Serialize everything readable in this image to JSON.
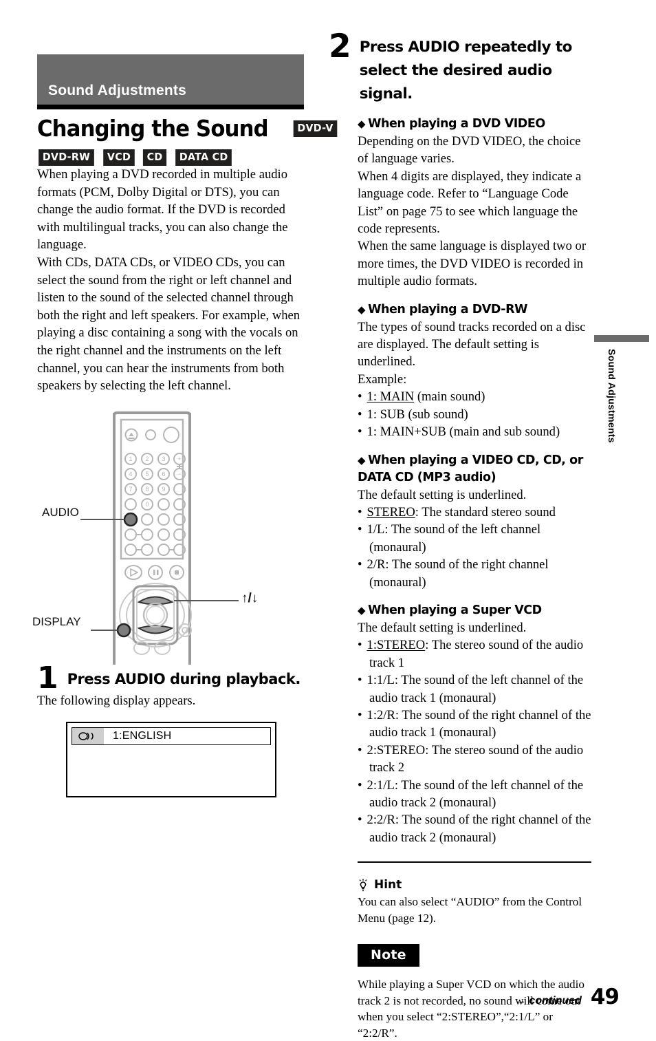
{
  "section": {
    "header": "Sound Adjustments",
    "title": "Changing the Sound",
    "badges_inline": [
      "DVD-V"
    ],
    "badges_row": [
      "DVD-RW",
      "VCD",
      "CD",
      "DATA CD"
    ]
  },
  "intro": {
    "p1": "When playing a DVD recorded in multiple audio formats (PCM, Dolby Digital or DTS), you can change the audio format. If the DVD is recorded with multilingual tracks, you can also change the language.",
    "p2": "With CDs, DATA CDs, or VIDEO CDs, you can select the sound from the right or left channel and listen to the sound of the selected channel through both the right and left speakers. For example, when playing a disc containing a song with the vocals on the right channel and the instruments on the left channel, you can hear the instruments from both speakers by selecting the left channel."
  },
  "remote": {
    "label_audio": "AUDIO",
    "label_display": "DISPLAY",
    "label_arrows": "↑/↓",
    "keypad_digits": [
      "1",
      "2",
      "3",
      "4",
      "5",
      "6",
      "7",
      "8",
      "9",
      "0"
    ],
    "volume_plus": "+",
    "volume_minus": "−"
  },
  "step1": {
    "number": "1",
    "heading": "Press AUDIO during playback.",
    "body": "The following display appears.",
    "osd_icon": "audio-waves-icon",
    "osd_text": "1:ENGLISH"
  },
  "step2": {
    "number": "2",
    "heading": "Press AUDIO repeatedly to select the desired audio signal.",
    "blocks": [
      {
        "heading": "When playing a DVD VIDEO",
        "paragraphs": [
          "Depending on the DVD VIDEO, the choice of language varies.",
          "When 4 digits are displayed, they indicate a language code. Refer to “Language Code List” on page 75 to see which language the code represents.",
          "When the same language is displayed two or more times, the DVD VIDEO is recorded in multiple audio formats."
        ],
        "bullets": []
      },
      {
        "heading": "When playing a DVD-RW",
        "paragraphs": [
          "The types of sound tracks recorded on a disc are displayed. The default setting is underlined.",
          "Example:"
        ],
        "bullets": [
          {
            "key": "1: MAIN",
            "underline": true,
            "rest": " (main sound)"
          },
          {
            "key": "1: SUB",
            "underline": false,
            "rest": " (sub sound)"
          },
          {
            "key": "1: MAIN+SUB",
            "underline": false,
            "rest": " (main and sub sound)"
          }
        ]
      },
      {
        "heading": "When playing a VIDEO CD, CD, or DATA CD (MP3 audio)",
        "paragraphs": [
          "The default setting is underlined."
        ],
        "bullets": [
          {
            "key": "STEREO",
            "underline": true,
            "rest": ": The standard stereo sound"
          },
          {
            "key": "1/L",
            "underline": false,
            "rest": ": The sound of the left channel (monaural)"
          },
          {
            "key": "2/R",
            "underline": false,
            "rest": ": The sound of the right channel (monaural)"
          }
        ]
      },
      {
        "heading": "When playing a Super VCD",
        "paragraphs": [
          "The default setting is underlined."
        ],
        "bullets": [
          {
            "key": "1:STEREO",
            "underline": true,
            "rest": ": The stereo sound of the audio track 1"
          },
          {
            "key": "1:1/L",
            "underline": false,
            "rest": ": The sound of the left channel of the audio track 1 (monaural)"
          },
          {
            "key": "1:2/R",
            "underline": false,
            "rest": ": The sound of the right channel of the audio track 1 (monaural)"
          },
          {
            "key": "2:STEREO",
            "underline": false,
            "rest": ": The stereo sound of the audio track 2"
          },
          {
            "key": "2:1/L",
            "underline": false,
            "rest": ": The sound of the left channel of the audio track 2 (monaural)"
          },
          {
            "key": "2:2/R",
            "underline": false,
            "rest": ": The sound of the right channel of the audio track 2 (monaural)"
          }
        ]
      }
    ]
  },
  "hint": {
    "label": "Hint",
    "text": "You can also select “AUDIO” from the Control Menu (page 12)."
  },
  "note": {
    "label": "Note",
    "text": "While playing a Super VCD on which the audio track 2 is not recorded, no sound will come out when you select “2:STEREO”,“2:1/L” or “2:2/R”."
  },
  "footer": {
    "continued": "→ continued",
    "page_number": "49"
  },
  "thumb_tab": {
    "label": "Sound Adjustments"
  },
  "colors": {
    "header_gray": "#6b6b6b",
    "badge_black": "#221f1f",
    "osd_icon_gray": "#cfcfcf"
  }
}
